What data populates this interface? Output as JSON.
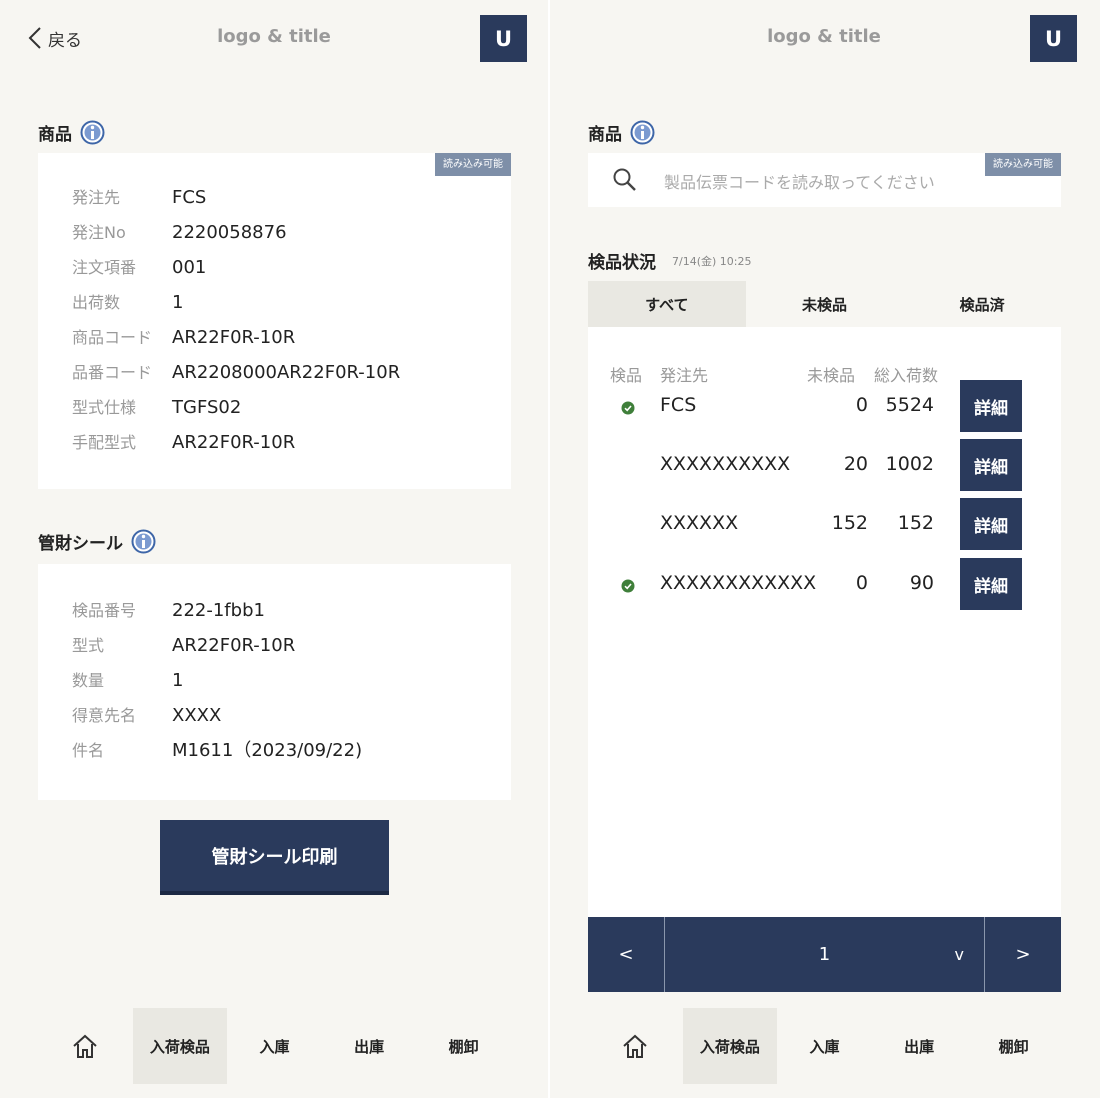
{
  "left": {
    "header": {
      "back_label": "戻る",
      "logo": "logo & title",
      "avatar": "U"
    },
    "product": {
      "title": "商品",
      "badge": "読み込み可能",
      "fields": [
        {
          "key": "発注先",
          "value": "FCS"
        },
        {
          "key": "発注No",
          "value": "2220058876"
        },
        {
          "key": "注文項番",
          "value": "001"
        },
        {
          "key": "出荷数",
          "value": "1"
        },
        {
          "key": "商品コード",
          "value": "AR22F0R-10R"
        },
        {
          "key": "品番コード",
          "value": "AR2208000AR22F0R-10R"
        },
        {
          "key": "型式仕様",
          "value": "TGFS02"
        },
        {
          "key": "手配型式",
          "value": "AR22F0R-10R"
        }
      ]
    },
    "seal": {
      "title": "管財シール",
      "fields": [
        {
          "key": "検品番号",
          "value": "222-1fbb1"
        },
        {
          "key": "型式",
          "value": "AR22F0R-10R"
        },
        {
          "key": "数量",
          "value": "1"
        },
        {
          "key": "得意先名",
          "value": "XXXX"
        },
        {
          "key": "件名",
          "value": "M1611（2023/09/22)"
        }
      ]
    },
    "print_button": "管財シール印刷",
    "tabbar": [
      "入荷検品",
      "入庫",
      "出庫",
      "棚卸"
    ]
  },
  "right": {
    "header": {
      "logo": "logo & title",
      "avatar": "U"
    },
    "product": {
      "title": "商品",
      "badge": "読み込み可能",
      "search_placeholder": "製品伝票コードを読み取ってください"
    },
    "status": {
      "title": "検品状況",
      "timestamp": "7/14(金) 10:25",
      "tabs": [
        "すべて",
        "未検品",
        "検品済"
      ],
      "columns": [
        "検品",
        "発注先",
        "未検品",
        "総入荷数"
      ],
      "rows": [
        {
          "checked": true,
          "vendor": "FCS",
          "pending": "0",
          "total": "5524",
          "detail": "詳細"
        },
        {
          "checked": false,
          "vendor": "XXXXXXXXXX",
          "pending": "20",
          "total": "1002",
          "detail": "詳細"
        },
        {
          "checked": false,
          "vendor": "XXXXXX",
          "pending": "152",
          "total": "152",
          "detail": "詳細"
        },
        {
          "checked": true,
          "vendor": "XXXXXXXXXXXX",
          "pending": "0",
          "total": "90",
          "detail": "詳細"
        }
      ]
    },
    "pager": {
      "prev": "<",
      "page": "1",
      "dropdown": "v",
      "next": ">"
    },
    "tabbar": [
      "入荷検品",
      "入庫",
      "出庫",
      "棚卸"
    ]
  },
  "colors": {
    "navy": "#2a3a5c",
    "badge": "#7e8fa8",
    "check": "#3f7f3a",
    "info": "#3e66a8"
  }
}
